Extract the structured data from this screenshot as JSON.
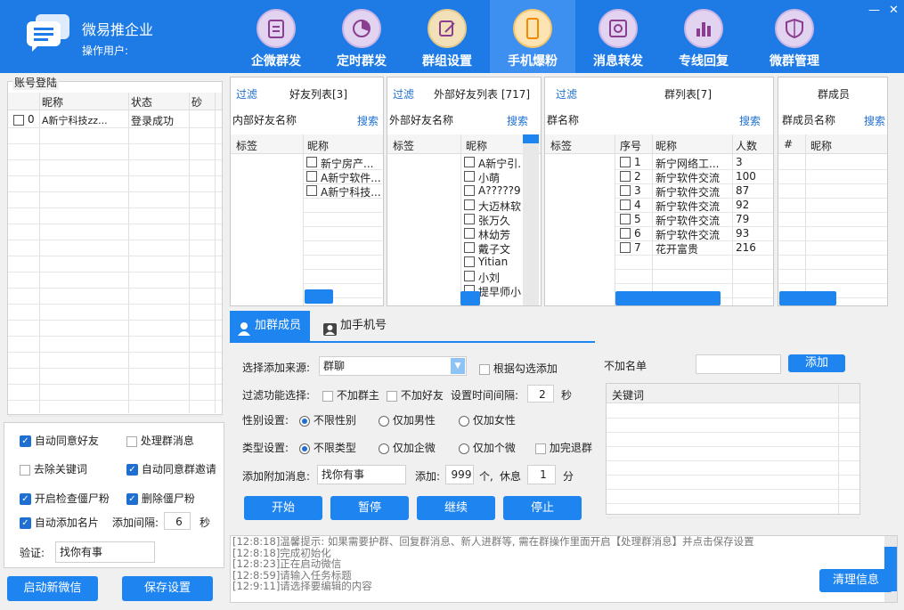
{
  "app": {
    "name": "微易推企业",
    "operator_label": "操作用户:"
  },
  "nav": [
    {
      "label": "企微群发",
      "icon": "clipboard-icon"
    },
    {
      "label": "定时群发",
      "icon": "pie-chart-icon"
    },
    {
      "label": "群组设置",
      "icon": "edit-icon"
    },
    {
      "label": "手机爆粉",
      "icon": "phone-icon"
    },
    {
      "label": "消息转发",
      "icon": "safe-icon"
    },
    {
      "label": "专线回复",
      "icon": "bar-chart-icon"
    },
    {
      "label": "微群管理",
      "icon": "shield-icon"
    }
  ],
  "window": {
    "minimize": "—",
    "close": "✕"
  },
  "accounts": {
    "title": "账号登陆",
    "cols": [
      "昵称",
      "状态",
      "砂"
    ],
    "rows": [
      {
        "idx": "0",
        "name": "A新宁科技zz...",
        "status": "登录成功"
      }
    ]
  },
  "options": {
    "auto_accept_friend": "自动同意好友",
    "handle_group_msg": "处理群消息",
    "remove_keyword": "去除关键词",
    "auto_accept_group_invite": "自动同意群邀请",
    "check_zombie": "开启检查僵尸粉",
    "delete_zombie": "删除僵尸粉",
    "auto_add_card": "自动添加名片",
    "add_interval_label": "添加间隔:",
    "add_interval": "6",
    "seconds": "秒",
    "verify_label": "验证:",
    "verify_value": "找你有事"
  },
  "bottom_buttons": {
    "start_wechat": "启动新微信",
    "save_settings": "保存设置"
  },
  "friends": {
    "filter": "过滤",
    "title": "好友列表[3]",
    "search_label": "内部好友名称",
    "search": "搜索",
    "col_tag": "标签",
    "col_name": "昵称",
    "rows": [
      "新宁房产...",
      "A新宁软件...",
      "A新宁科技..."
    ]
  },
  "external": {
    "filter": "过滤",
    "title": "外部好友列表 [717]",
    "search_label": "外部好友名称",
    "search": "搜索",
    "col_tag": "标签",
    "col_name": "昵称",
    "rows": [
      "A新宁引.",
      "小萌",
      "A?????9",
      "大迈林软",
      "张万久",
      "林幼芳",
      "戴子文",
      "Yitian",
      "小刘",
      "提早师小"
    ]
  },
  "groups": {
    "filter": "过滤",
    "title": "群列表[7]",
    "search_label": "群名称",
    "search": "搜索",
    "col_tag": "标签",
    "col_no": "序号",
    "col_name": "昵称",
    "col_count": "人数",
    "rows": [
      {
        "no": "1",
        "name": "新宁网络工...",
        "count": "3"
      },
      {
        "no": "2",
        "name": "新宁软件交流",
        "count": "100"
      },
      {
        "no": "3",
        "name": "新宁软件交流",
        "count": "87"
      },
      {
        "no": "4",
        "name": "新宁软件交流",
        "count": "92"
      },
      {
        "no": "5",
        "name": "新宁软件交流",
        "count": "79"
      },
      {
        "no": "6",
        "name": "新宁软件交流",
        "count": "93"
      },
      {
        "no": "7",
        "name": "花开富贵",
        "count": "216"
      }
    ]
  },
  "members": {
    "title": "群成员",
    "search_label": "群成员名称",
    "search": "搜索",
    "col_no": "#",
    "col_name": "昵称"
  },
  "tabs": {
    "add_group_member": "加群成员",
    "add_phone": "加手机号"
  },
  "form": {
    "source_label": "选择添加来源:",
    "source_value": "群聊",
    "by_checked": "根据勾选添加",
    "filter_label": "过滤功能选择:",
    "no_owner": "不加群主",
    "no_friend": "不加好友",
    "interval_label": "设置时间间隔:",
    "interval": "2",
    "sec": "秒",
    "gender_label": "性别设置:",
    "gender_any": "不限性别",
    "gender_male": "仅加男性",
    "gender_female": "仅加女性",
    "type_label": "类型设置:",
    "type_any": "不限类型",
    "type_corp": "仅加企微",
    "type_personal": "仅加个微",
    "quit_after": "加完退群",
    "msg_label": "添加附加消息:",
    "msg_value": "找你有事",
    "add_label": "添加:",
    "add_count": "999",
    "unit_ge": "个,",
    "rest_label": "休息",
    "rest": "1",
    "unit_min": "分",
    "blacklist_label": "不加名单",
    "add_btn": "添加",
    "keyword_col": "关键词"
  },
  "actions": {
    "start": "开始",
    "pause": "暂停",
    "resume": "继续",
    "stop": "停止"
  },
  "log": {
    "lines": [
      "[12:8:18]温馨提示: 如果需要护群、回复群消息、新人进群等, 需在群操作里面开启【处理群消息】并点击保存设置",
      "[12:8:18]完成初始化",
      "[12:8:23]正在启动微信",
      "[12:8:59]请输入任务标题",
      "[12:9:11]请选择要编辑的内容"
    ],
    "clear": "清理信息"
  }
}
